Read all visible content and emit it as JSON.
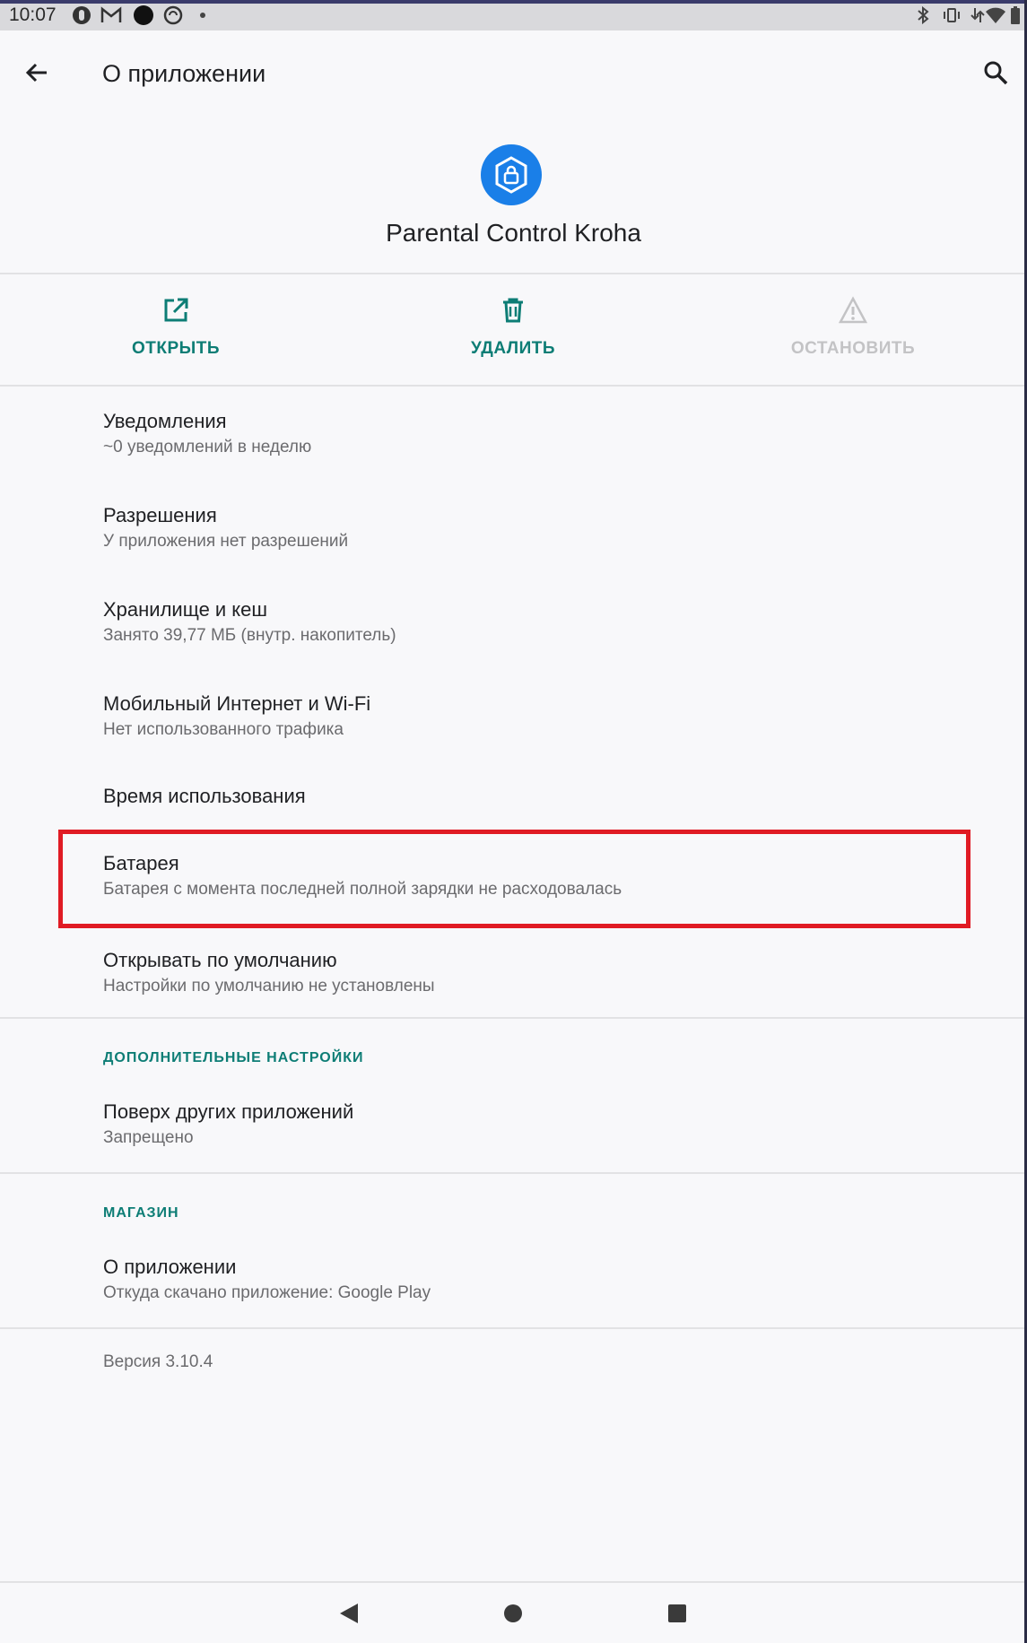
{
  "status_bar": {
    "time": "10:07"
  },
  "app_bar": {
    "title": "О приложении"
  },
  "app": {
    "name": "Parental Control Kroha",
    "icon_color": "#1a7fe8"
  },
  "actions": [
    {
      "label": "ОТКРЫТЬ",
      "icon": "open-external-icon",
      "enabled": true
    },
    {
      "label": "УДАЛИТЬ",
      "icon": "trash-icon",
      "enabled": true
    },
    {
      "label": "ОСТАНОВИТЬ",
      "icon": "warning-icon",
      "enabled": false
    }
  ],
  "items": [
    {
      "title": "Уведомления",
      "subtitle": "~0 уведомлений в неделю"
    },
    {
      "title": "Разрешения",
      "subtitle": "У приложения нет разрешений"
    },
    {
      "title": "Хранилище и кеш",
      "subtitle": "Занято 39,77 МБ (внутр. накопитель)"
    },
    {
      "title": "Мобильный Интернет и Wi-Fi",
      "subtitle": "Нет использованного трафика"
    },
    {
      "title": "Время использования",
      "subtitle": ""
    },
    {
      "title": "Батарея",
      "subtitle": "Батарея с момента последней полной зарядки не расходовалась"
    },
    {
      "title": "Открывать по умолчанию",
      "subtitle": "Настройки по умолчанию не установлены"
    }
  ],
  "advanced": {
    "header": "ДОПОЛНИТЕЛЬНЫЕ НАСТРОЙКИ",
    "items": [
      {
        "title": "Поверх других приложений",
        "subtitle": "Запрещено"
      }
    ]
  },
  "store": {
    "header": "МАГАЗИН",
    "items": [
      {
        "title": "О приложении",
        "subtitle": "Откуда скачано приложение: Google Play"
      }
    ]
  },
  "version": "Версия 3.10.4",
  "colors": {
    "accent": "#0d7d75",
    "highlight": "#e01b24",
    "disabled": "#c3c3c5"
  }
}
